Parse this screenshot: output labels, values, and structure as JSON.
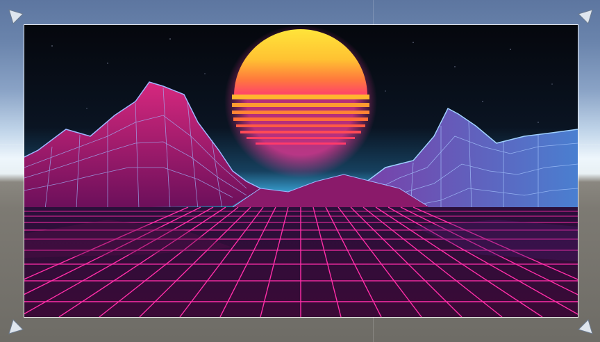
{
  "scene": {
    "background": "#6b84ab",
    "ground_color": "#7d7a73"
  },
  "canvas_image": {
    "description_colors": {
      "sky_top": "#06080f",
      "sky_horizon": "#3aa6d8",
      "sun_top": "#ffe43a",
      "sun_bottom": "#ff3f6e",
      "sun_glow": "#ff3aa0",
      "grid_line": "#ff2ea8",
      "mountain_fill": "#c0186a",
      "mountain_line": "#9fb6ff"
    }
  },
  "handles": [
    {
      "name": "top-left"
    },
    {
      "name": "top-right"
    },
    {
      "name": "bottom-left"
    },
    {
      "name": "bottom-right"
    }
  ]
}
